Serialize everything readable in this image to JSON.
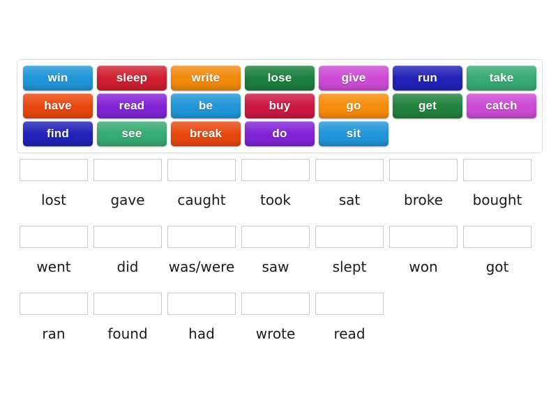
{
  "activity": {
    "type": "match-up-drag-and-drop",
    "tile_bank": {
      "name": "irregular-verbs-base-forms",
      "tiles": [
        {
          "label": "win",
          "color": "#2196d8"
        },
        {
          "label": "sleep",
          "color": "#ce2030"
        },
        {
          "label": "write",
          "color": "#f28a0c"
        },
        {
          "label": "lose",
          "color": "#1b7f3e"
        },
        {
          "label": "give",
          "color": "#cd4bd4"
        },
        {
          "label": "run",
          "color": "#2222b8"
        },
        {
          "label": "take",
          "color": "#37ab72"
        },
        {
          "label": "have",
          "color": "#e8480f"
        },
        {
          "label": "read",
          "color": "#8224d6"
        },
        {
          "label": "be",
          "color": "#2196d8"
        },
        {
          "label": "buy",
          "color": "#cc1840"
        },
        {
          "label": "go",
          "color": "#f78c0c"
        },
        {
          "label": "get",
          "color": "#22823f"
        },
        {
          "label": "catch",
          "color": "#cd4bd4"
        },
        {
          "label": "find",
          "color": "#2222b8"
        },
        {
          "label": "see",
          "color": "#37ab72"
        },
        {
          "label": "break",
          "color": "#e8480f"
        },
        {
          "label": "do",
          "color": "#8224d6"
        },
        {
          "label": "sit",
          "color": "#2196d8"
        }
      ]
    },
    "answer_rows": [
      {
        "cells": [
          {
            "drop_value": "",
            "label": "lost"
          },
          {
            "drop_value": "",
            "label": "gave"
          },
          {
            "drop_value": "",
            "label": "caught"
          },
          {
            "drop_value": "",
            "label": "took"
          },
          {
            "drop_value": "",
            "label": "sat"
          },
          {
            "drop_value": "",
            "label": "broke"
          },
          {
            "drop_value": "",
            "label": "bought"
          }
        ]
      },
      {
        "cells": [
          {
            "drop_value": "",
            "label": "went"
          },
          {
            "drop_value": "",
            "label": "did"
          },
          {
            "drop_value": "",
            "label": "was/were"
          },
          {
            "drop_value": "",
            "label": "saw"
          },
          {
            "drop_value": "",
            "label": "slept"
          },
          {
            "drop_value": "",
            "label": "won"
          },
          {
            "drop_value": "",
            "label": "got"
          }
        ]
      },
      {
        "cells": [
          {
            "drop_value": "",
            "label": "ran"
          },
          {
            "drop_value": "",
            "label": "found"
          },
          {
            "drop_value": "",
            "label": "had"
          },
          {
            "drop_value": "",
            "label": "wrote"
          },
          {
            "drop_value": "",
            "label": "read"
          }
        ]
      }
    ]
  },
  "colors": {
    "page_background": "#ffffff",
    "bank_border": "#dcdcdc",
    "dropzone_border": "#c8c8c8",
    "label_text": "#1a1a1a",
    "tile_text": "#ffffff"
  }
}
